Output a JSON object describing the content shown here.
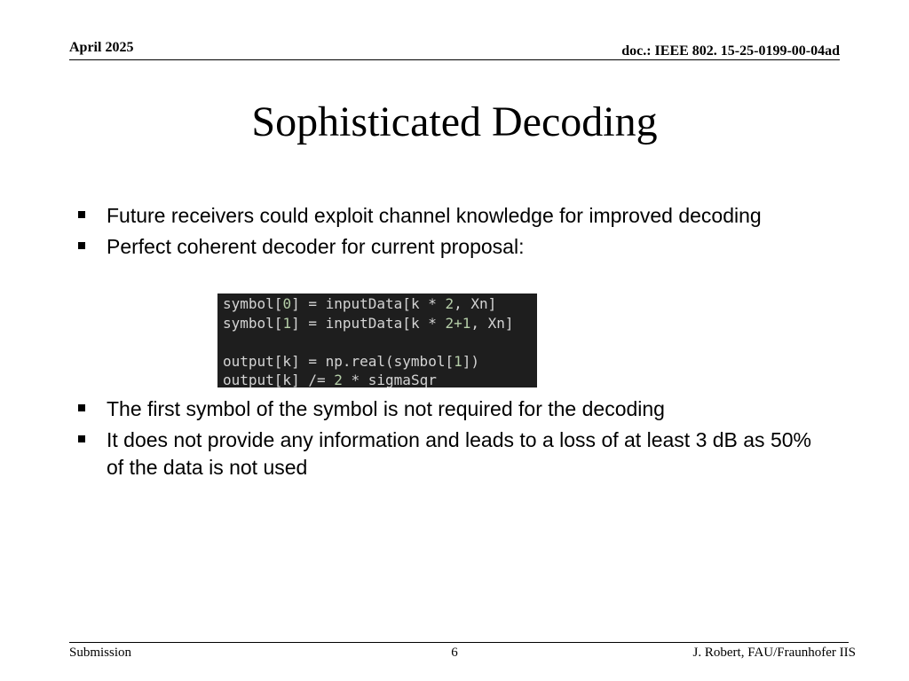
{
  "header": {
    "date": "April 2025",
    "doc": "doc.: IEEE 802. 15-25-0199-00-04ad"
  },
  "title": "Sophisticated Decoding",
  "bullets_top": [
    "Future receivers could exploit channel knowledge for improved decoding",
    "Perfect coherent decoder for current proposal:"
  ],
  "code": {
    "line1_a": "symbol[",
    "line1_n1": "0",
    "line1_b": "] = inputData[k * ",
    "line1_n2": "2",
    "line1_c": ", Xn]",
    "line2_a": "symbol[",
    "line2_n1": "1",
    "line2_b": "] = inputData[k * ",
    "line2_n2": "2+1",
    "line2_c": ", Xn]",
    "line4_a": "output[k] = np.real(symbol[",
    "line4_n1": "1",
    "line4_b": "])",
    "line5_a": "output[k] /= ",
    "line5_n1": "2",
    "line5_b": " * sigmaSqr"
  },
  "bullets_bottom": [
    "The first symbol of the symbol is not required for the decoding",
    "It does not provide any information and leads to a loss of at least 3 dB as 50% of the data is not used"
  ],
  "footer": {
    "left": "Submission",
    "page": "6",
    "right": "J. Robert, FAU/Fraunhofer IIS"
  }
}
